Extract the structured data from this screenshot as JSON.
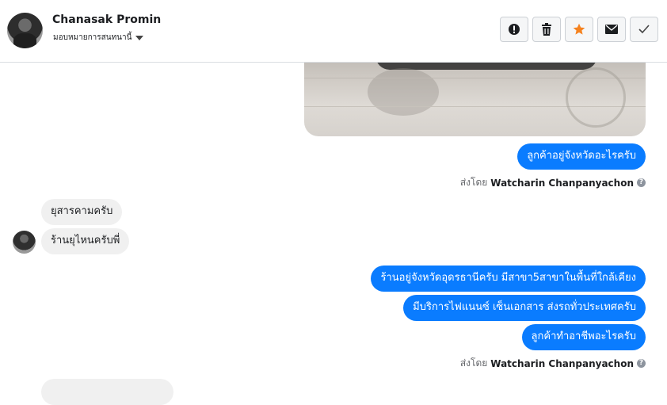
{
  "header": {
    "contact_name": "Chanasak Promin",
    "assign_label": "มอบหมายการสนทนานี้",
    "actions": [
      {
        "icon": "alert-icon",
        "label": "spam"
      },
      {
        "icon": "trash-icon",
        "label": "delete"
      },
      {
        "icon": "star-icon",
        "label": "star"
      },
      {
        "icon": "envelope-icon",
        "label": "mark-unread"
      },
      {
        "icon": "check-icon",
        "label": "done"
      }
    ]
  },
  "colors": {
    "outgoing_bubble": "#0a7cff",
    "incoming_bubble": "#f0f0f0",
    "star": "#f5821f"
  },
  "messages": {
    "out1": "ลูกค้าอยู่จังหวัดอะไรครับ",
    "sent_by_prefix": "ส่งโดย",
    "sent_by_name": "Watcharin Chanpanyachon",
    "in1": "ยุสารคามครับ",
    "in2": "ร้านยุไหนครับพี่",
    "out2": "ร้านอยู่จังหวัดอุดรธานีครับ มีสาขา5สาขาในพื้นที่ใกล้เคียง",
    "out3": "มีบริการไฟแนนซ์ เซ็นเอกสาร ส่งรถทั่วประเทศครับ",
    "out4": "ลูกค้าทำอาชีพอะไรครับ",
    "sent_by_prefix_2": "ส่งโดย",
    "sent_by_name_2": "Watcharin Chanpanyachon"
  }
}
